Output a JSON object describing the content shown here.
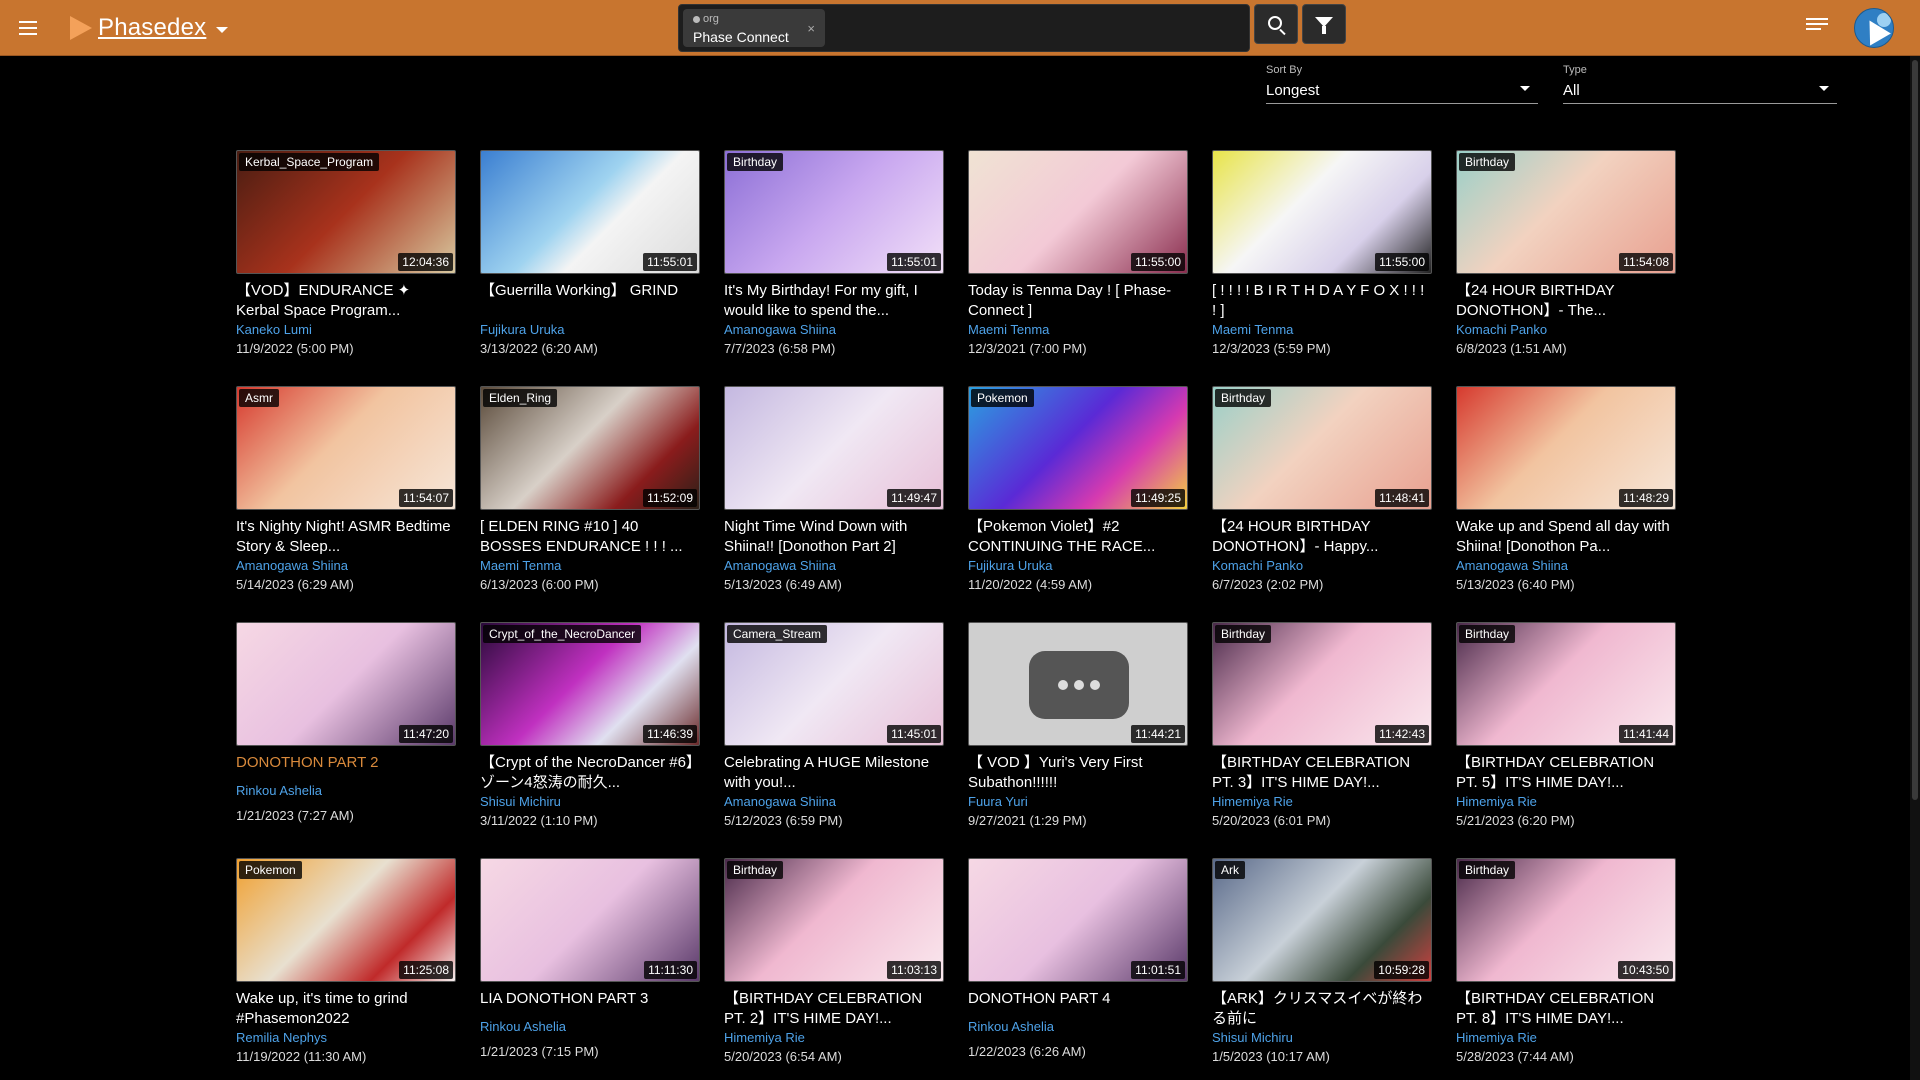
{
  "app": {
    "name": "Phasedex"
  },
  "search": {
    "chip_type": "org",
    "chip_label": "Phase Connect",
    "chip_close": "×"
  },
  "sort": {
    "label": "Sort By",
    "value": "Longest"
  },
  "type": {
    "label": "Type",
    "value": "All"
  },
  "colors": {
    "topbar": "#c8752f",
    "link": "#4ea2e8",
    "accent_title": "#d98a3c"
  },
  "videos": [
    {
      "tag": "Kerbal_Space_Program",
      "duration": "12:04:36",
      "title": "【VOD】ENDURANCE ✦ Kerbal Space Program...",
      "channel": "Kaneko Lumi",
      "date": "11/9/2022 (5:00 PM)",
      "bg": "linear-gradient(135deg,#4a1d12,#a8321c 50%,#d8c9a0)"
    },
    {
      "tag": "",
      "duration": "11:55:01",
      "title": "【Guerrilla Working】 GRIND",
      "channel": "Fujikura Uruka",
      "date": "3/13/2022 (6:20 AM)",
      "bg": "linear-gradient(135deg,#3b7fd1,#9fd3f0 45%,#f4f4f4 60%,#dcdcdc)"
    },
    {
      "tag": "Birthday",
      "duration": "11:55:01",
      "title": "It's My Birthday! For my gift, I would like to spend the...",
      "channel": "Amanogawa Shiina",
      "date": "7/7/2023 (6:58 PM)",
      "bg": "linear-gradient(135deg,#8c6fd6,#c9a8f0 50%,#f2e0f8)"
    },
    {
      "tag": "",
      "duration": "11:55:00",
      "title": "Today is Tenma Day ! [ Phase-Connect ]",
      "channel": "Maemi Tenma",
      "date": "12/3/2021 (7:00 PM)",
      "bg": "linear-gradient(135deg,#f0e3d3,#f3c9d6 50%,#8a2e4f)"
    },
    {
      "tag": "",
      "duration": "11:55:00",
      "title": "[ ! ! ! ! B I R T H D A Y F O X ! ! ! ! ]",
      "channel": "Maemi Tenma",
      "date": "12/3/2023 (5:59 PM)",
      "bg": "linear-gradient(135deg,#e8e44a,#f6f6f6 40%,#d8d0ea 70%,#222)"
    },
    {
      "tag": "Birthday",
      "duration": "11:54:08",
      "title": "【24 HOUR BIRTHDAY DONOTHON】- The...",
      "channel": "Komachi Panko",
      "date": "6/8/2023 (1:51 AM)",
      "bg": "linear-gradient(135deg,#9ad0c8,#f2d2c0 45%,#e8a090)"
    },
    {
      "tag": "Asmr",
      "duration": "11:54:07",
      "title": "It's Nighty Night! ASMR Bedtime Story & Sleep...",
      "channel": "Amanogawa Shiina",
      "date": "5/14/2023 (6:29 AM)",
      "bg": "linear-gradient(135deg,#d63a2e,#f2c4a0 45%,#f6e6d8)"
    },
    {
      "tag": "Elden_Ring",
      "duration": "11:52:09",
      "title": "[ ELDEN RING #10 ] 40 BOSSES ENDURANCE ! ! ! ...",
      "channel": "Maemi Tenma",
      "date": "6/13/2023 (6:00 PM)",
      "bg": "linear-gradient(135deg,#5a4a3a,#d8d0c8 45%,#8a1c1c 75%,#2a2018)"
    },
    {
      "tag": "",
      "duration": "11:49:47",
      "title": "Night Time Wind Down with Shiina!! [Donothon Part 2]",
      "channel": "Amanogawa Shiina",
      "date": "5/13/2023 (6:49 AM)",
      "bg": "linear-gradient(135deg,#c4b8e0,#f0e8f4 50%,#e8c0d8)"
    },
    {
      "tag": "Pokemon",
      "duration": "11:49:25",
      "title": "【Pokemon Violet】#2 CONTINUING THE RACE...",
      "channel": "Fujikura Uruka",
      "date": "11/20/2022 (4:59 AM)",
      "bg": "linear-gradient(135deg,#2aa0e0,#5a2ad6 45%,#d63ab0 70%,#f2d040)"
    },
    {
      "tag": "Birthday",
      "duration": "11:48:41",
      "title": "【24 HOUR BIRTHDAY DONOTHON】- Happy...",
      "channel": "Komachi Panko",
      "date": "6/7/2023 (2:02 PM)",
      "bg": "linear-gradient(135deg,#9ad0c8,#f2d2c0 45%,#e8a090)"
    },
    {
      "tag": "",
      "duration": "11:48:29",
      "title": "Wake up and Spend all day with Shiina! [Donothon Pa...",
      "channel": "Amanogawa Shiina",
      "date": "5/13/2023 (6:40 PM)",
      "bg": "linear-gradient(135deg,#d63a2e,#f2c4a0 45%,#f6e6d8)"
    },
    {
      "tag": "",
      "duration": "11:47:20",
      "title": "DONOTHON PART 2",
      "channel": "Rinkou Ashelia",
      "date": "1/21/2023 (7:27 AM)",
      "bg": "linear-gradient(135deg,#f6d8e4,#e8c0e0 50%,#5a3a6a)",
      "single": true
    },
    {
      "tag": "Crypt_of_the_NecroDancer",
      "duration": "11:46:39",
      "title": "【Crypt of the NecroDancer #6】ゾーン4怒涛の耐久...",
      "channel": "Shisui Michiru",
      "date": "3/11/2022 (1:10 PM)",
      "bg": "linear-gradient(135deg,#2a0a3a,#c030c0 45%,#e0e0f0 70%,#6a2a2a)"
    },
    {
      "tag": "Camera_Stream",
      "duration": "11:45:01",
      "title": "Celebrating A HUGE Milestone with you!...",
      "channel": "Amanogawa Shiina",
      "date": "5/12/2023 (6:59 PM)",
      "bg": "linear-gradient(135deg,#c4b8e0,#f0e8f4 50%,#e8c0d8)"
    },
    {
      "tag": "",
      "duration": "11:44:21",
      "title": "【 VOD 】Yuri's Very First Subathon!!!!!!",
      "channel": "Fuura Yuri",
      "date": "9/27/2021 (1:29 PM)",
      "bg": "#cfcfcf",
      "placeholder": true
    },
    {
      "tag": "Birthday",
      "duration": "11:42:43",
      "title": "【BIRTHDAY CELEBRATION PT. 3】IT'S HIME DAY!...",
      "channel": "Himemiya Rie",
      "date": "5/20/2023 (6:01 PM)",
      "bg": "linear-gradient(135deg,#4a2a4a,#f0b8d0 45%,#fae8ee)"
    },
    {
      "tag": "Birthday",
      "duration": "11:41:44",
      "title": "【BIRTHDAY CELEBRATION PT. 5】IT'S HIME DAY!...",
      "channel": "Himemiya Rie",
      "date": "5/21/2023 (6:20 PM)",
      "bg": "linear-gradient(135deg,#4a2a4a,#f0b8d0 45%,#fae8ee)"
    },
    {
      "tag": "Pokemon",
      "duration": "11:25:08",
      "title": "Wake up, it's time to grind #Phasemon2022",
      "channel": "Remilia Nephys",
      "date": "11/19/2022 (11:30 AM)",
      "bg": "linear-gradient(135deg,#f0a030,#e8e0d0 45%,#c02a2a 75%,#f6f0f0)"
    },
    {
      "tag": "",
      "duration": "11:11:30",
      "title": "LIA DONOTHON PART 3",
      "channel": "Rinkou Ashelia",
      "date": "1/21/2023 (7:15 PM)",
      "bg": "linear-gradient(135deg,#f6d8e4,#e8c0e0 50%,#5a3a6a)",
      "single": true,
      "plain": true
    },
    {
      "tag": "Birthday",
      "duration": "11:03:13",
      "title": "【BIRTHDAY CELEBRATION PT. 2】IT'S HIME DAY!...",
      "channel": "Himemiya Rie",
      "date": "5/20/2023 (6:54 AM)",
      "bg": "linear-gradient(135deg,#4a2a4a,#f0b8d0 45%,#fae8ee)"
    },
    {
      "tag": "",
      "duration": "11:01:51",
      "title": "DONOTHON PART 4",
      "channel": "Rinkou Ashelia",
      "date": "1/22/2023 (6:26 AM)",
      "bg": "linear-gradient(135deg,#f6d8e4,#e8c0e0 50%,#5a3a6a)",
      "single": true,
      "plain": true
    },
    {
      "tag": "Ark",
      "duration": "10:59:28",
      "title": "【ARK】クリスマスイベが終わる前に",
      "channel": "Shisui Michiru",
      "date": "1/5/2023 (10:17 AM)",
      "bg": "linear-gradient(135deg,#5a6a8a,#c8d0d8 45%,#3a4a3a 75%,#d04040)"
    },
    {
      "tag": "Birthday",
      "duration": "10:43:50",
      "title": "【BIRTHDAY CELEBRATION PT. 8】IT'S HIME DAY!...",
      "channel": "Himemiya Rie",
      "date": "5/28/2023 (7:44 AM)",
      "bg": "linear-gradient(135deg,#4a2a4a,#f0b8d0 45%,#fae8ee)"
    }
  ]
}
